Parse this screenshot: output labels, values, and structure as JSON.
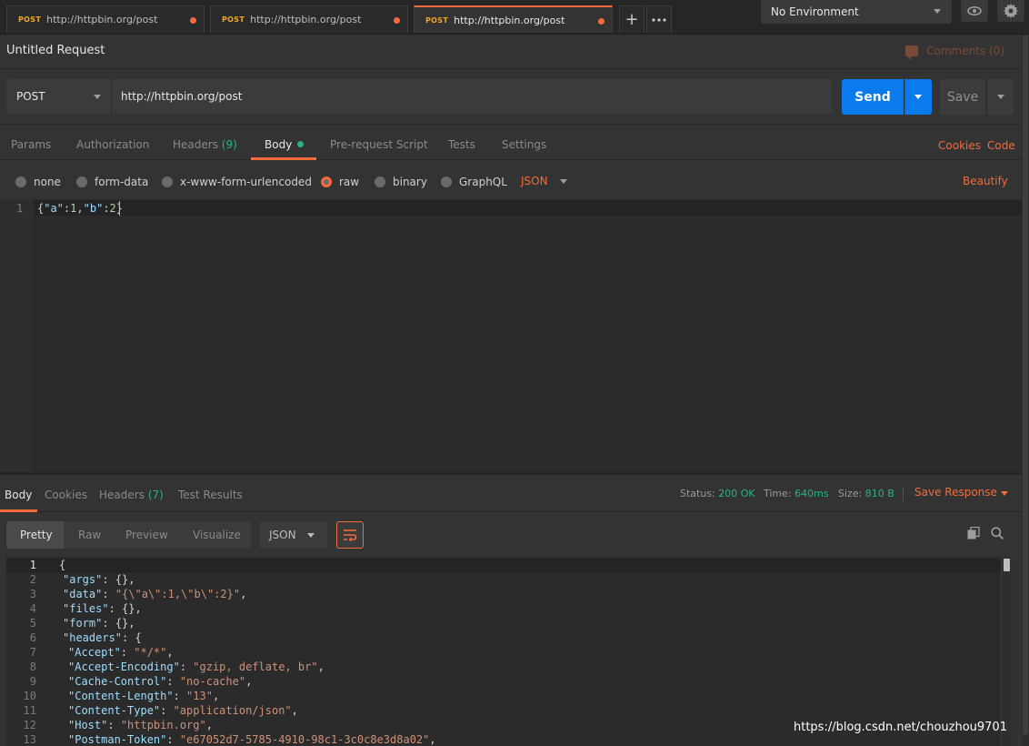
{
  "tabs": [
    {
      "method": "POST",
      "url": "http://httpbin.org/post"
    },
    {
      "method": "POST",
      "url": "http://httpbin.org/post"
    },
    {
      "method": "POST",
      "url": "http://httpbin.org/post"
    }
  ],
  "environment": {
    "selected": "No Environment"
  },
  "request": {
    "title": "Untitled Request",
    "comments": "Comments (0)",
    "method": "POST",
    "url": "http://httpbin.org/post",
    "send_label": "Send",
    "save_label": "Save"
  },
  "request_tabs": {
    "params": "Params",
    "authorization": "Authorization",
    "headers": "Headers",
    "headers_count": "(9)",
    "body": "Body",
    "pre_request": "Pre-request Script",
    "tests": "Tests",
    "settings": "Settings",
    "cookies": "Cookies",
    "code": "Code"
  },
  "body_types": {
    "none": "none",
    "form_data": "form-data",
    "urlencoded": "x-www-form-urlencoded",
    "raw": "raw",
    "binary": "binary",
    "graphql": "GraphQL",
    "language": "JSON",
    "beautify": "Beautify"
  },
  "request_body": {
    "line": "1",
    "open": "{",
    "k1": "\"a\"",
    "c1": ":",
    "v1": "1",
    "sep": ",",
    "k2": "\"b\"",
    "c2": ":",
    "v2": "2",
    "close": "}"
  },
  "response_tabs": {
    "body": "Body",
    "cookies": "Cookies",
    "headers": "Headers",
    "headers_count": "(7)",
    "test_results": "Test Results"
  },
  "response_meta": {
    "status_label": "Status:",
    "status": "200 OK",
    "time_label": "Time:",
    "time": "640ms",
    "size_label": "Size:",
    "size": "810 B",
    "save_response": "Save Response"
  },
  "response_view": {
    "pretty": "Pretty",
    "raw": "Raw",
    "preview": "Preview",
    "visualize": "Visualize",
    "language": "JSON"
  },
  "response_lines": [
    {
      "n": "1",
      "key": "",
      "sep": "",
      "val": "",
      "tail": "{"
    },
    {
      "n": "2",
      "key": "\"args\"",
      "sep": ": ",
      "val": "",
      "tail": "{},"
    },
    {
      "n": "3",
      "key": "\"data\"",
      "sep": ": ",
      "val": "\"{\\\"a\\\":1,\\\"b\\\":2}\"",
      "tail": ","
    },
    {
      "n": "4",
      "key": "\"files\"",
      "sep": ": ",
      "val": "",
      "tail": "{},"
    },
    {
      "n": "5",
      "key": "\"form\"",
      "sep": ": ",
      "val": "",
      "tail": "{},"
    },
    {
      "n": "6",
      "key": "\"headers\"",
      "sep": ": ",
      "val": "",
      "tail": "{"
    },
    {
      "n": "7",
      "key": "\"Accept\"",
      "sep": ": ",
      "val": "\"*/*\"",
      "tail": ","
    },
    {
      "n": "8",
      "key": "\"Accept-Encoding\"",
      "sep": ": ",
      "val": "\"gzip, deflate, br\"",
      "tail": ","
    },
    {
      "n": "9",
      "key": "\"Cache-Control\"",
      "sep": ": ",
      "val": "\"no-cache\"",
      "tail": ","
    },
    {
      "n": "10",
      "key": "\"Content-Length\"",
      "sep": ": ",
      "val": "\"13\"",
      "tail": ","
    },
    {
      "n": "11",
      "key": "\"Content-Type\"",
      "sep": ": ",
      "val": "\"application/json\"",
      "tail": ","
    },
    {
      "n": "12",
      "key": "\"Host\"",
      "sep": ": ",
      "val": "\"httpbin.org\"",
      "tail": ","
    },
    {
      "n": "13",
      "key": "\"Postman-Token\"",
      "sep": ": ",
      "val": "\"e67052d7-5785-4910-98c1-3c0c8e3d8a02\"",
      "tail": ","
    }
  ],
  "watermark": "https://blog.csdn.net/chouzhou9701",
  "colors": {
    "accent": "#f26b3a",
    "send": "#097bed",
    "success": "#26b47f"
  }
}
